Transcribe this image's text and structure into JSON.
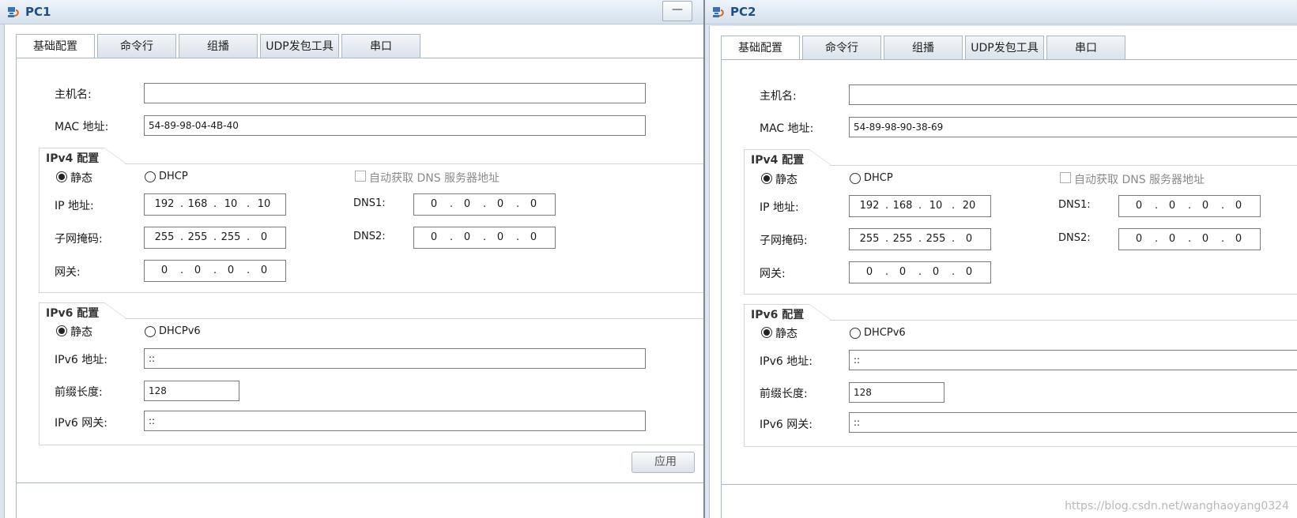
{
  "windows": [
    {
      "title": "PC1",
      "minimize_label": "—",
      "tabs": [
        "基础配置",
        "命令行",
        "组播",
        "UDP发包工具",
        "串口"
      ],
      "hostname_label": "主机名:",
      "hostname_value": "",
      "mac_label": "MAC 地址:",
      "mac_value": "54-89-98-04-4B-40",
      "ipv4_title": "IPv4 配置",
      "static_label": "静态",
      "dhcp_label": "DHCP",
      "auto_dns_label": "自动获取 DNS 服务器地址",
      "ip_label": "IP 地址:",
      "ip": [
        "192",
        "168",
        "10",
        "10"
      ],
      "mask_label": "子网掩码:",
      "mask": [
        "255",
        "255",
        "255",
        "0"
      ],
      "gateway_label": "网关:",
      "gateway": [
        "0",
        "0",
        "0",
        "0"
      ],
      "dns1_label": "DNS1:",
      "dns1": [
        "0",
        "0",
        "0",
        "0"
      ],
      "dns2_label": "DNS2:",
      "dns2": [
        "0",
        "0",
        "0",
        "0"
      ],
      "ipv6_title": "IPv6 配置",
      "static6_label": "静态",
      "dhcpv6_label": "DHCPv6",
      "ipv6_addr_label": "IPv6 地址:",
      "ipv6_addr_value": "::",
      "prefix_label": "前缀长度:",
      "prefix_value": "128",
      "ipv6_gw_label": "IPv6 网关:",
      "ipv6_gw_value": "::",
      "apply_label": "应用"
    },
    {
      "title": "PC2",
      "tabs": [
        "基础配置",
        "命令行",
        "组播",
        "UDP发包工具",
        "串口"
      ],
      "hostname_label": "主机名:",
      "hostname_value": "",
      "mac_label": "MAC 地址:",
      "mac_value": "54-89-98-90-38-69",
      "ipv4_title": "IPv4 配置",
      "static_label": "静态",
      "dhcp_label": "DHCP",
      "auto_dns_label": "自动获取 DNS 服务器地址",
      "ip_label": "IP 地址:",
      "ip": [
        "192",
        "168",
        "10",
        "20"
      ],
      "mask_label": "子网掩码:",
      "mask": [
        "255",
        "255",
        "255",
        "0"
      ],
      "gateway_label": "网关:",
      "gateway": [
        "0",
        "0",
        "0",
        "0"
      ],
      "dns1_label": "DNS1:",
      "dns1": [
        "0",
        "0",
        "0",
        "0"
      ],
      "dns2_label": "DNS2:",
      "dns2": [
        "0",
        "0",
        "0",
        "0"
      ],
      "ipv6_title": "IPv6 配置",
      "static6_label": "静态",
      "dhcpv6_label": "DHCPv6",
      "ipv6_addr_label": "IPv6 地址:",
      "ipv6_addr_value": "::",
      "prefix_label": "前缀长度:",
      "prefix_value": "128",
      "ipv6_gw_label": "IPv6 网关:",
      "ipv6_gw_value": "::"
    }
  ],
  "watermark": "https://blog.csdn.net/wanghaoyang0324",
  "colors": {
    "title_text": "#1d4f86",
    "window_frame": "#dde6ef",
    "border": "#a9b6c4"
  }
}
